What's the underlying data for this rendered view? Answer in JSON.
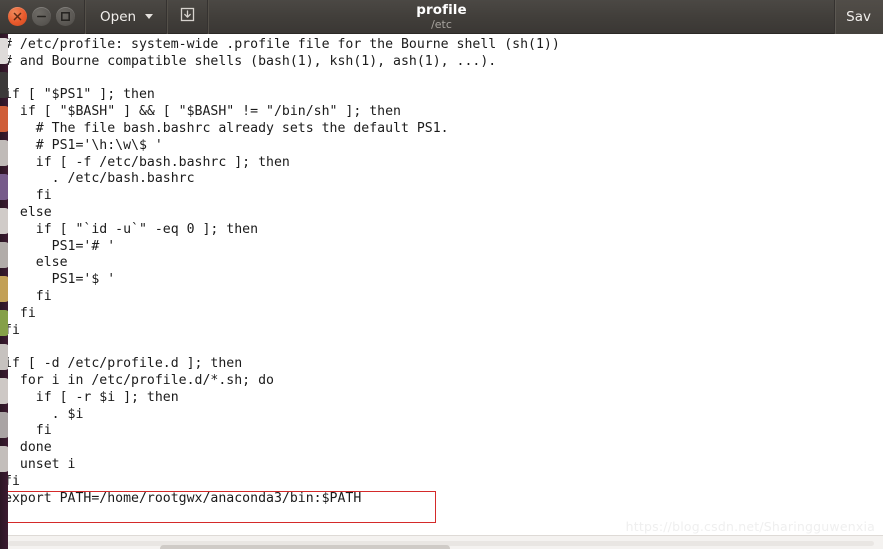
{
  "window": {
    "title": "profile",
    "subtitle": "/etc",
    "controls": {
      "close_label": "close",
      "minimize_label": "minimize",
      "maximize_label": "maximize"
    }
  },
  "toolbar": {
    "open_label": "Open",
    "save_icon_name": "save-icon",
    "save_label": "Sav"
  },
  "editor": {
    "content": "# /etc/profile: system-wide .profile file for the Bourne shell (sh(1))\n# and Bourne compatible shells (bash(1), ksh(1), ash(1), ...).\n\nif [ \"$PS1\" ]; then\n  if [ \"$BASH\" ] && [ \"$BASH\" != \"/bin/sh\" ]; then\n    # The file bash.bashrc already sets the default PS1.\n    # PS1='\\h:\\w\\$ '\n    if [ -f /etc/bash.bashrc ]; then\n      . /etc/bash.bashrc\n    fi\n  else\n    if [ \"`id -u`\" -eq 0 ]; then\n      PS1='# '\n    else\n      PS1='$ '\n    fi\n  fi\nfi\n\nif [ -d /etc/profile.d ]; then\n  for i in /etc/profile.d/*.sh; do\n    if [ -r $i ]; then\n      . $i\n    fi\n  done\n  unset i\nfi\nexport PATH=/home/rootgwx/anaconda3/bin:$PATH",
    "highlighted_line": "export PATH=/home/rootgwx/anaconda3/bin:$PATH",
    "highlight_color": "#d42a2a"
  },
  "watermark": {
    "text": "https://blog.csdn.net/Sharingguwenxia"
  },
  "colors": {
    "titlebar": "#413e3a",
    "close_button": "#e8592b",
    "editor_background": "#ffffff",
    "editor_text": "#1b1b1b",
    "launcher": "#34182b"
  }
}
